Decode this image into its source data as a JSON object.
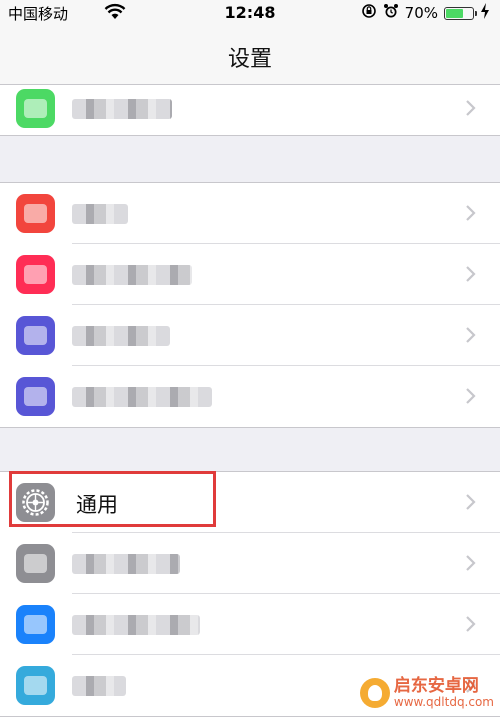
{
  "status_bar": {
    "carrier": "中国移动",
    "time": "12:48",
    "battery_percent": "70%",
    "battery_level": 0.7
  },
  "nav": {
    "title": "设置"
  },
  "colors": {
    "background": "#efeff4",
    "accent_highlight": "#e03b3b",
    "battery_fill": "#4cd964"
  },
  "group1": {
    "rows": [
      {
        "icon": "messages-icon",
        "icon_color": "#4cd964",
        "label": ""
      }
    ]
  },
  "group2": {
    "rows": [
      {
        "icon": "notifications-icon",
        "icon_color": "#f2453d",
        "label": ""
      },
      {
        "icon": "sounds-icon",
        "icon_color": "#ff2d55",
        "label": ""
      },
      {
        "icon": "do-not-disturb-icon",
        "icon_color": "#5856d6",
        "label": ""
      },
      {
        "icon": "screen-time-icon",
        "icon_color": "#5856d6",
        "label": ""
      }
    ]
  },
  "group3": {
    "rows": [
      {
        "icon": "gear-icon",
        "icon_color": "#8e8e93",
        "label": "通用"
      },
      {
        "icon": "control-center-icon",
        "icon_color": "#8e8e93",
        "label": ""
      },
      {
        "icon": "display-icon",
        "icon_color": "#1a82fb",
        "label": ""
      },
      {
        "icon": "wallpaper-icon",
        "icon_color": "#35aadc",
        "label": ""
      }
    ]
  },
  "watermark": {
    "name": "启东安卓网",
    "url": "www.qdltdq.com"
  }
}
